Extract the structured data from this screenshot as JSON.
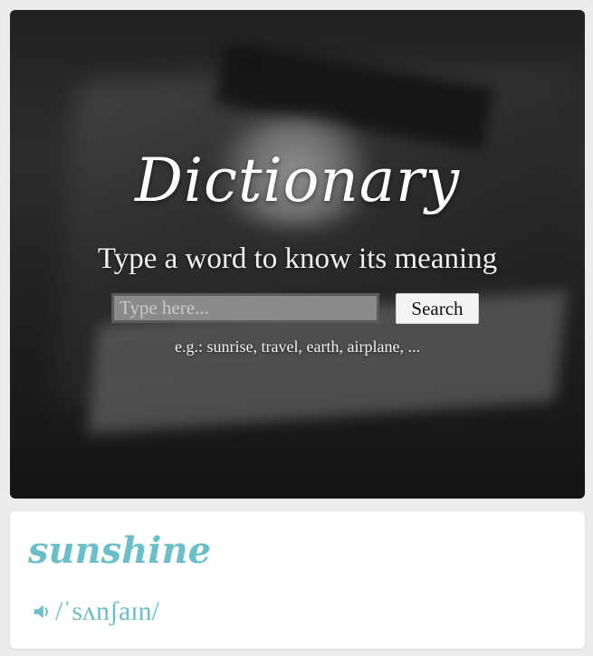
{
  "hero": {
    "title": "Dictionary",
    "subtitle": "Type a word to know its meaning",
    "search": {
      "placeholder": "Type here...",
      "value": "",
      "button_label": "Search"
    },
    "examples": "e.g.: sunrise, travel, earth, airplane, ..."
  },
  "result": {
    "word": "sunshine",
    "phonetic": "/ˈsʌnʃaɪn/",
    "audio_icon": "speaker-icon"
  },
  "colors": {
    "accent": "#6bbfc9",
    "hero_text": "#ffffff",
    "page_background": "#ececec"
  }
}
